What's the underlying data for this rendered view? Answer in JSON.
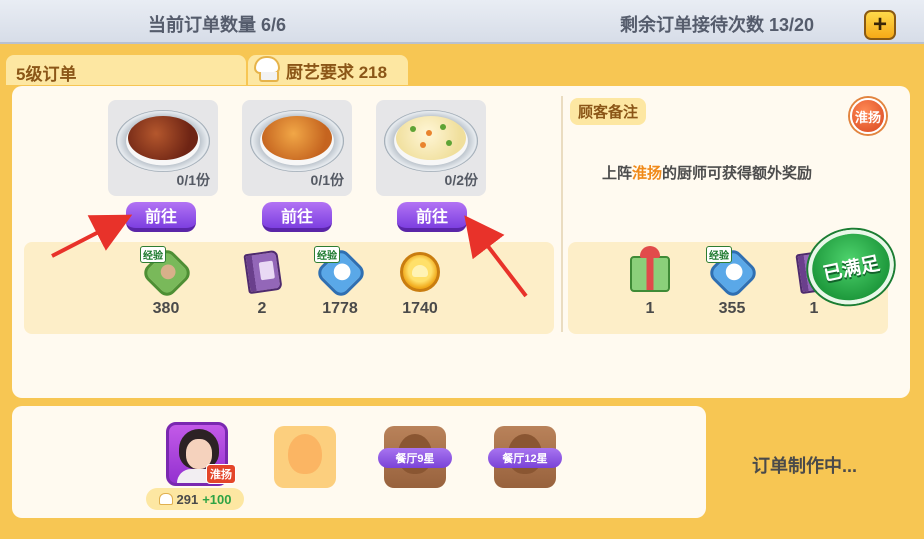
{
  "topbar": {
    "order_count": "当前订单数量 6/6",
    "remaining_receptions": "剩余订单接待次数 13/20",
    "add_label": "+"
  },
  "order": {
    "level_label": "5级订单",
    "skill_requirement": "厨艺要求 218"
  },
  "dishes": [
    {
      "portion": "0/1份",
      "go_label": "前往"
    },
    {
      "portion": "0/1份",
      "go_label": "前往"
    },
    {
      "portion": "0/2份",
      "go_label": "前往"
    }
  ],
  "rewards": [
    {
      "icon": "chef-exp-icon",
      "tag": "经验",
      "value": "380"
    },
    {
      "icon": "recipe-book-icon",
      "value": "2"
    },
    {
      "icon": "kitchen-exp-icon",
      "tag": "经验",
      "value": "1778"
    },
    {
      "icon": "gold-coin-icon",
      "value": "1740"
    }
  ],
  "note": {
    "label": "顾客备注",
    "region_badge": "淮扬",
    "text_prefix": "上阵",
    "text_highlight": "淮扬",
    "text_suffix": "的厨师可获得额外奖励"
  },
  "bonus_rewards": [
    {
      "icon": "gift-box-icon",
      "value": "1"
    },
    {
      "icon": "kitchen-exp-icon",
      "tag": "经验",
      "value": "355"
    },
    {
      "icon": "recipe-book-icon",
      "value": "1"
    }
  ],
  "satisfied_badge": "已满足",
  "chef_slots": {
    "chef_region": "淮扬",
    "chef_score": "291",
    "chef_bonus": "+100",
    "locked_slot_1": "餐厅9星",
    "locked_slot_2": "餐厅12星"
  },
  "status": "订单制作中...",
  "colors": {
    "background": "#f7c653",
    "button_purple": "#7d3fe0",
    "highlight_orange": "#f08a1a",
    "satisfied_green": "#1f9a3d",
    "arrow_red": "#e8322a"
  }
}
